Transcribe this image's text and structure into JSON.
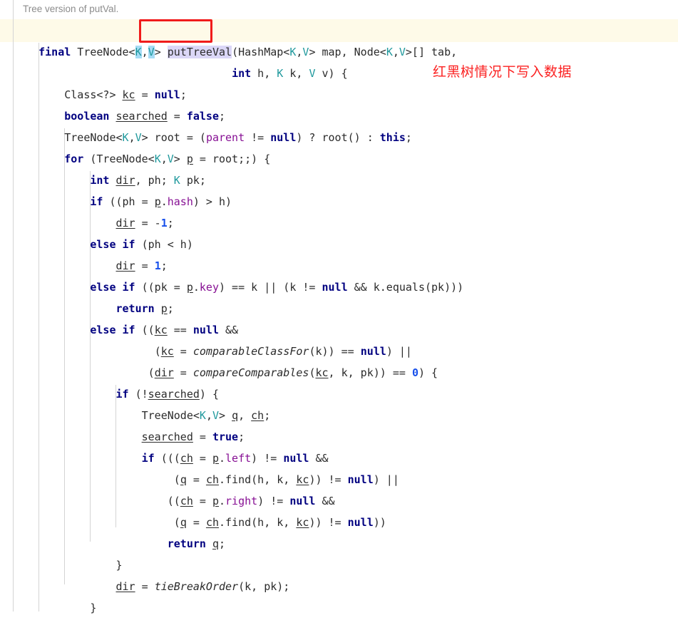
{
  "editor": {
    "doc_comment": "Tree version of putVal.",
    "highlighted_symbol": "putTreeVal",
    "annotation_text": "红黑树情况下写入数据",
    "colors": {
      "keyword": "#000080",
      "type_param": "#20999d",
      "field": "#871094",
      "number": "#1750eb",
      "text": "#2b2b2b",
      "doc_comment": "#8c8c8c",
      "current_line_band": "#fefae8",
      "identifier_highlight": "#dbd7f7",
      "type_highlight": "#a6dcf5",
      "annotation_red": "#fb2222",
      "box_red": "#f01b1b",
      "indent_guide": "#d4d4d4",
      "background": "#ffffff"
    },
    "code_lines": [
      "final TreeNode<K,V> putTreeVal(HashMap<K,V> map, Node<K,V>[] tab,",
      "                              int h, K k, V v) {",
      "    Class<?> kc = null;",
      "    boolean searched = false;",
      "    TreeNode<K,V> root = (parent != null) ? root() : this;",
      "    for (TreeNode<K,V> p = root;;) {",
      "        int dir, ph; K pk;",
      "        if ((ph = p.hash) > h)",
      "            dir = -1;",
      "        else if (ph < h)",
      "            dir = 1;",
      "        else if ((pk = p.key) == k || (k != null && k.equals(pk)))",
      "            return p;",
      "        else if ((kc == null &&",
      "                  (kc = comparableClassFor(k)) == null) ||",
      "                 (dir = compareComparables(kc, k, pk)) == 0) {",
      "            if (!searched) {",
      "                TreeNode<K,V> q, ch;",
      "                searched = true;",
      "                if (((ch = p.left) != null &&",
      "                     (q = ch.find(h, k, kc)) != null) ||",
      "                    ((ch = p.right) != null &&",
      "                     (q = ch.find(h, k, kc)) != null))",
      "                    return q;",
      "            }",
      "            dir = tieBreakOrder(k, pk);",
      "        }"
    ]
  }
}
